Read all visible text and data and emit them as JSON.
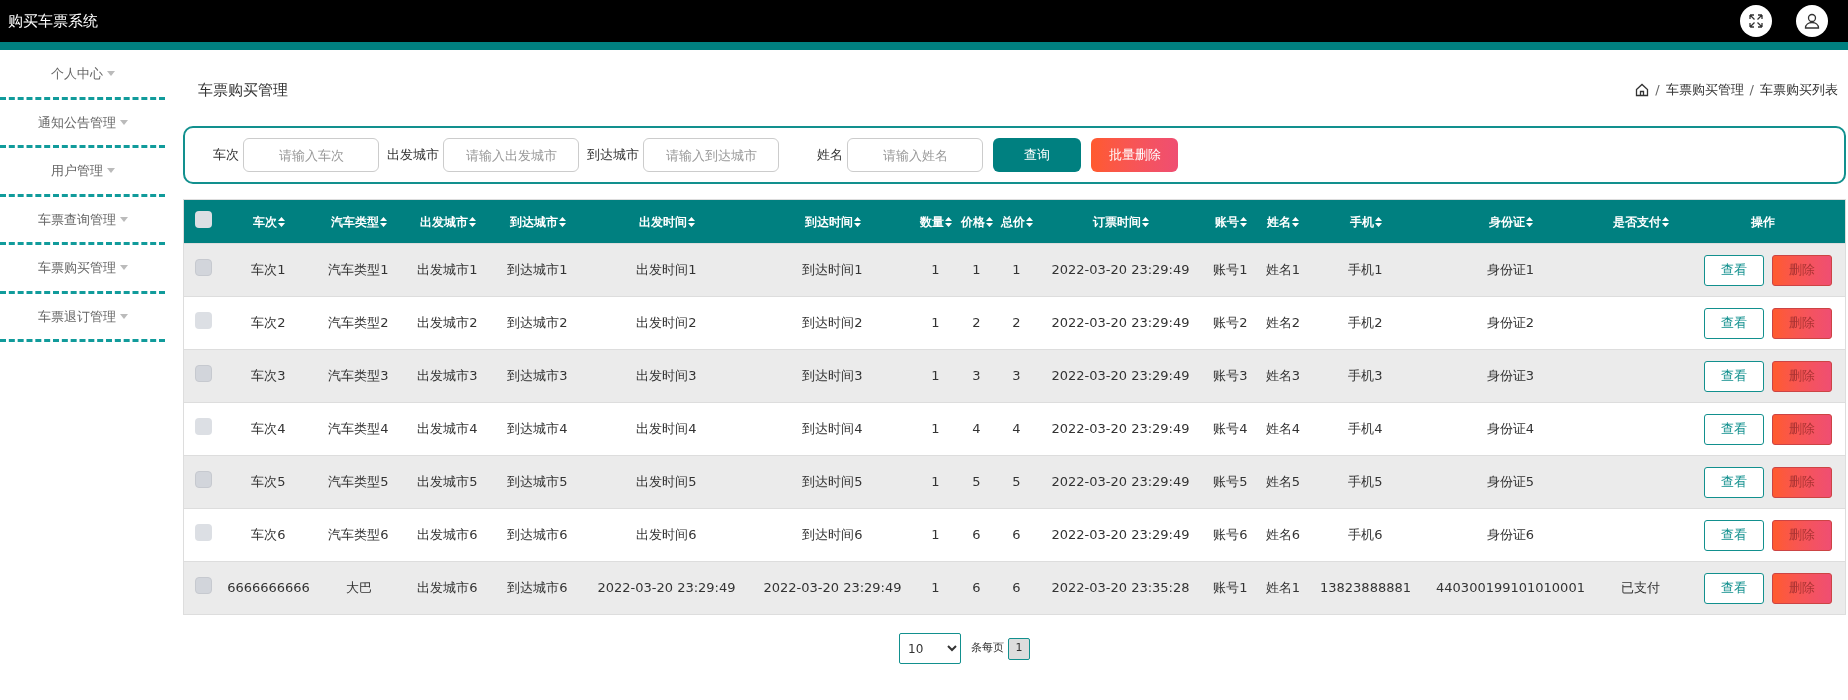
{
  "app_title": "购买车票系统",
  "sidebar": {
    "items": [
      {
        "label": "个人中心"
      },
      {
        "label": "通知公告管理"
      },
      {
        "label": "用户管理"
      },
      {
        "label": "车票查询管理"
      },
      {
        "label": "车票购买管理"
      },
      {
        "label": "车票退订管理"
      }
    ]
  },
  "page_title": "车票购买管理",
  "breadcrumb": {
    "separator": "/",
    "items": [
      "车票购买管理",
      "车票购买列表"
    ]
  },
  "search": {
    "fields": [
      {
        "label": "车次",
        "placeholder": "请输入车次"
      },
      {
        "label": "出发城市",
        "placeholder": "请输入出发城市"
      },
      {
        "label": "到达城市",
        "placeholder": "请输入到达城市"
      },
      {
        "label": "姓名",
        "placeholder": "请输入姓名"
      }
    ],
    "buttons": [
      {
        "kind": "primary",
        "label": "查询"
      },
      {
        "kind": "danger",
        "label": "批量删除"
      }
    ]
  },
  "table": {
    "select_all": {
      "checked": false
    },
    "columns": [
      "车次",
      "汽车类型",
      "出发城市",
      "到达城市",
      "出发时间",
      "到达时间",
      "数量",
      "价格",
      "总价",
      "订票时间",
      "账号",
      "姓名",
      "手机",
      "身份证",
      "是否支付"
    ],
    "actions_column": "操作",
    "rows": [
      {
        "checked": false,
        "cells": [
          "车次1",
          "汽车类型1",
          "出发城市1",
          "到达城市1",
          "出发时间1",
          "到达时间1",
          "1",
          "1",
          "1",
          "2022-03-20 23:29:49",
          "账号1",
          "姓名1",
          "手机1",
          "身份证1",
          ""
        ],
        "actions": [
          "查看",
          "删除"
        ]
      },
      {
        "checked": false,
        "cells": [
          "车次2",
          "汽车类型2",
          "出发城市2",
          "到达城市2",
          "出发时间2",
          "到达时间2",
          "1",
          "2",
          "2",
          "2022-03-20 23:29:49",
          "账号2",
          "姓名2",
          "手机2",
          "身份证2",
          ""
        ],
        "actions": [
          "查看",
          "删除"
        ]
      },
      {
        "checked": false,
        "cells": [
          "车次3",
          "汽车类型3",
          "出发城市3",
          "到达城市3",
          "出发时间3",
          "到达时间3",
          "1",
          "3",
          "3",
          "2022-03-20 23:29:49",
          "账号3",
          "姓名3",
          "手机3",
          "身份证3",
          ""
        ],
        "actions": [
          "查看",
          "删除"
        ]
      },
      {
        "checked": false,
        "cells": [
          "车次4",
          "汽车类型4",
          "出发城市4",
          "到达城市4",
          "出发时间4",
          "到达时间4",
          "1",
          "4",
          "4",
          "2022-03-20 23:29:49",
          "账号4",
          "姓名4",
          "手机4",
          "身份证4",
          ""
        ],
        "actions": [
          "查看",
          "删除"
        ]
      },
      {
        "checked": false,
        "cells": [
          "车次5",
          "汽车类型5",
          "出发城市5",
          "到达城市5",
          "出发时间5",
          "到达时间5",
          "1",
          "5",
          "5",
          "2022-03-20 23:29:49",
          "账号5",
          "姓名5",
          "手机5",
          "身份证5",
          ""
        ],
        "actions": [
          "查看",
          "删除"
        ]
      },
      {
        "checked": false,
        "cells": [
          "车次6",
          "汽车类型6",
          "出发城市6",
          "到达城市6",
          "出发时间6",
          "到达时间6",
          "1",
          "6",
          "6",
          "2022-03-20 23:29:49",
          "账号6",
          "姓名6",
          "手机6",
          "身份证6",
          ""
        ],
        "actions": [
          "查看",
          "删除"
        ]
      },
      {
        "checked": false,
        "cells": [
          "6666666666",
          "大巴",
          "出发城市6",
          "到达城市6",
          "2022-03-20 23:29:49",
          "2022-03-20 23:29:49",
          "1",
          "6",
          "6",
          "2022-03-20 23:35:28",
          "账号1",
          "姓名1",
          "13823888881",
          "440300199101010001",
          "已支付"
        ],
        "actions": [
          "查看",
          "删除"
        ]
      }
    ]
  },
  "pagination": {
    "page_size": "10",
    "page_size_label": "条每页",
    "pages": [
      {
        "label": "1",
        "selected": true
      }
    ]
  }
}
